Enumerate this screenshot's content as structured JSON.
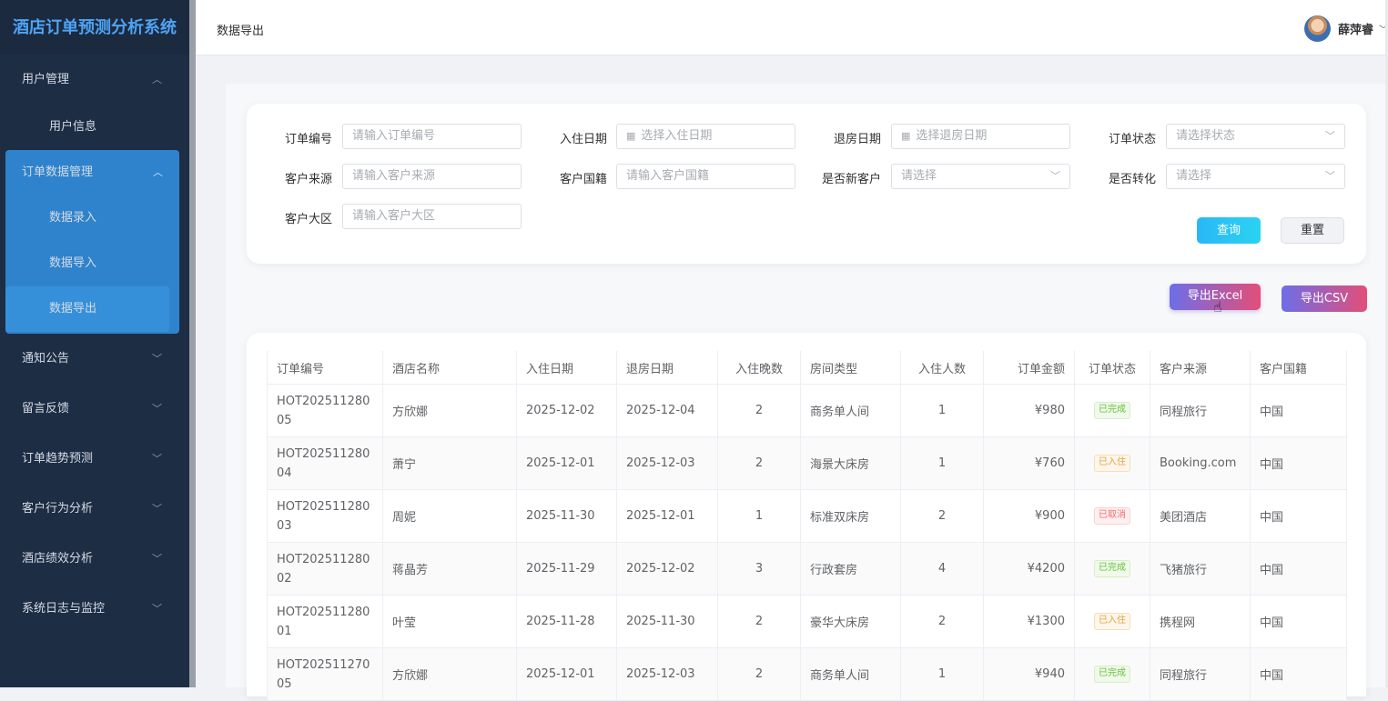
{
  "app": {
    "title": "酒店订单预测分析系统"
  },
  "sidebar": {
    "groups": [
      {
        "label": "用户管理",
        "chevron": "^",
        "children": [
          "用户信息"
        ]
      },
      {
        "label": "订单数据管理",
        "chevron": "^",
        "children": [
          "数据录入",
          "数据导入",
          "数据导出"
        ]
      },
      {
        "label": "通知公告",
        "chevron": "v"
      },
      {
        "label": "留言反馈",
        "chevron": "v"
      },
      {
        "label": "订单趋势预测",
        "chevron": "v"
      },
      {
        "label": "客户行为分析",
        "chevron": "v"
      },
      {
        "label": "酒店绩效分析",
        "chevron": "v"
      },
      {
        "label": "系统日志与监控",
        "chevron": "v"
      }
    ],
    "active_item": "数据导出"
  },
  "header": {
    "breadcrumb": "数据导出",
    "user_name": "薛萍睿"
  },
  "filters": {
    "order_no": {
      "label": "订单编号",
      "placeholder": "请输入订单编号"
    },
    "checkin": {
      "label": "入住日期",
      "placeholder": "选择入住日期"
    },
    "checkout": {
      "label": "退房日期",
      "placeholder": "选择退房日期"
    },
    "status": {
      "label": "订单状态",
      "placeholder": "请选择状态"
    },
    "source": {
      "label": "客户来源",
      "placeholder": "请输入客户来源"
    },
    "nationality": {
      "label": "客户国籍",
      "placeholder": "请输入客户国籍"
    },
    "is_new": {
      "label": "是否新客户",
      "placeholder": "请选择"
    },
    "converted": {
      "label": "是否转化",
      "placeholder": "请选择"
    },
    "region": {
      "label": "客户大区",
      "placeholder": "请输入客户大区"
    },
    "query_button": "查询",
    "reset_button": "重置"
  },
  "export": {
    "excel_button": "导出Excel",
    "csv_button": "导出CSV"
  },
  "table": {
    "columns": [
      "订单编号",
      "酒店名称",
      "入住日期",
      "退房日期",
      "入住晚数",
      "房间类型",
      "入住人数",
      "订单金额",
      "订单状态",
      "客户来源",
      "客户国籍"
    ],
    "rows": [
      [
        "HOT20251128005",
        "方欣娜",
        "2025-12-02",
        "2025-12-04",
        "2",
        "商务单人间",
        "1",
        "¥980",
        "已完成",
        "同程旅行",
        "中国"
      ],
      [
        "HOT20251128004",
        "萧宁",
        "2025-12-01",
        "2025-12-03",
        "2",
        "海景大床房",
        "1",
        "¥760",
        "已入住",
        "Booking.com",
        "中国"
      ],
      [
        "HOT20251128003",
        "周妮",
        "2025-11-30",
        "2025-12-01",
        "1",
        "标准双床房",
        "2",
        "¥900",
        "已取消",
        "美团酒店",
        "中国"
      ],
      [
        "HOT20251128002",
        "蒋晶芳",
        "2025-11-29",
        "2025-12-02",
        "3",
        "行政套房",
        "4",
        "¥4200",
        "已完成",
        "飞猪旅行",
        "中国"
      ],
      [
        "HOT20251128001",
        "叶莹",
        "2025-11-28",
        "2025-11-30",
        "2",
        "豪华大床房",
        "2",
        "¥1300",
        "已入住",
        "携程网",
        "中国"
      ],
      [
        "HOT20251127005",
        "方欣娜",
        "2025-12-01",
        "2025-12-03",
        "2",
        "商务单人间",
        "1",
        "¥940",
        "已完成",
        "同程旅行",
        "中国"
      ]
    ],
    "status_colors": {
      "已完成": "#67c23a",
      "已入住": "#e6a23c",
      "已取消": "#f56c6c"
    }
  }
}
